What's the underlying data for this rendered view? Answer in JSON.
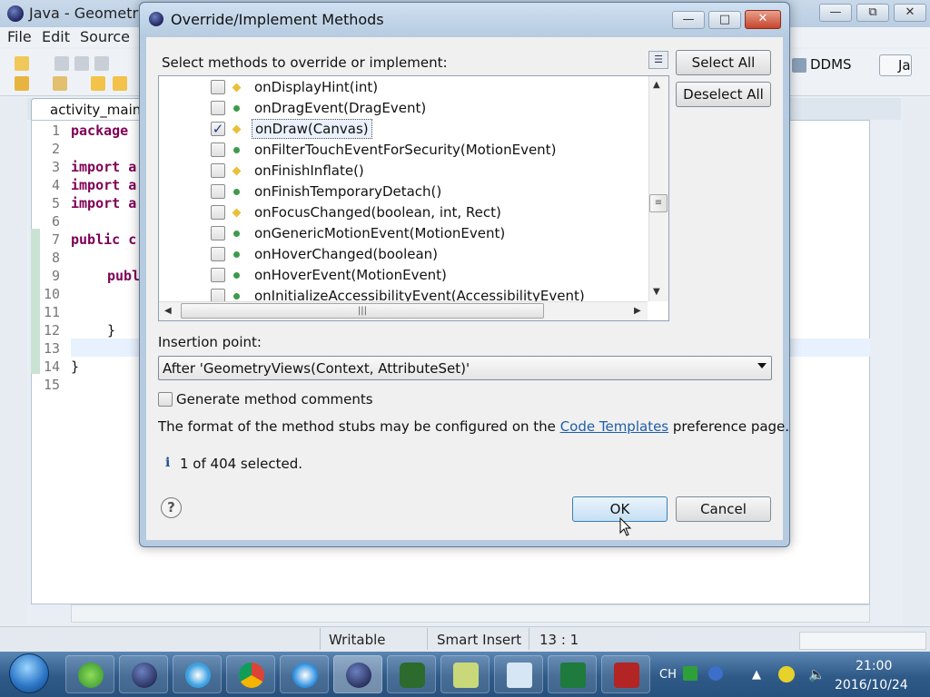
{
  "eclipse": {
    "title": "Java - GeometryV",
    "menu": [
      "File",
      "Edit",
      "Source"
    ],
    "perspectives": [
      "DDMS",
      "Ja"
    ],
    "editor_tab": "activity_main.",
    "line_numbers": [
      "1",
      "2",
      "3",
      "4",
      "5",
      "6",
      "7",
      "8",
      "9",
      "10",
      "11",
      "12",
      "13",
      "14",
      "15"
    ],
    "code_lines": [
      {
        "line": 1,
        "text": "package"
      },
      {
        "line": 3,
        "text": "import a"
      },
      {
        "line": 4,
        "text": "import a"
      },
      {
        "line": 5,
        "text": "import a"
      },
      {
        "line": 7,
        "text": "public c"
      },
      {
        "line": 9,
        "text": "publ"
      },
      {
        "line": 12,
        "text": "}"
      },
      {
        "line": 14,
        "text": "}"
      }
    ],
    "status": {
      "mode": "Writable",
      "insert": "Smart Insert",
      "position": "13 : 1"
    }
  },
  "dialog": {
    "title": "Override/Implement Methods",
    "methods_label": "Select methods to override or implement:",
    "methods": [
      {
        "name": "onDisplayHint(int)",
        "visibility": "protected",
        "checked": false
      },
      {
        "name": "onDragEvent(DragEvent)",
        "visibility": "public",
        "checked": false
      },
      {
        "name": "onDraw(Canvas)",
        "visibility": "protected",
        "checked": true,
        "selected": true
      },
      {
        "name": "onFilterTouchEventForSecurity(MotionEvent)",
        "visibility": "public",
        "checked": false
      },
      {
        "name": "onFinishInflate()",
        "visibility": "protected",
        "checked": false
      },
      {
        "name": "onFinishTemporaryDetach()",
        "visibility": "public",
        "checked": false
      },
      {
        "name": "onFocusChanged(boolean, int, Rect)",
        "visibility": "protected",
        "checked": false
      },
      {
        "name": "onGenericMotionEvent(MotionEvent)",
        "visibility": "public",
        "checked": false
      },
      {
        "name": "onHoverChanged(boolean)",
        "visibility": "public",
        "checked": false
      },
      {
        "name": "onHoverEvent(MotionEvent)",
        "visibility": "public",
        "checked": false
      },
      {
        "name": "onInitializeAccessibilityEvent(AccessibilityEvent)",
        "visibility": "public",
        "checked": false
      }
    ],
    "select_all": "Select All",
    "deselect_all": "Deselect All",
    "insertion_label": "Insertion point:",
    "insertion_value": "After 'GeometryViews(Context, AttributeSet)'",
    "generate_comments": "Generate method comments",
    "format_prefix": "The format of the method stubs may be configured on the",
    "format_link": "Code Templates",
    "format_suffix": "preference page.",
    "info_icon": "i",
    "selection_count": "1 of 404 selected.",
    "help_icon": "?",
    "ok": "OK",
    "cancel": "Cancel"
  },
  "taskbar": {
    "tray_lang": "CH",
    "time": "21:00",
    "date": "2016/10/24"
  },
  "colors": {
    "link": "#1f5ea8",
    "public_dot": "#3f9a4c",
    "protected_diamond": "#e8c03a",
    "close_button": "#c6452c"
  }
}
